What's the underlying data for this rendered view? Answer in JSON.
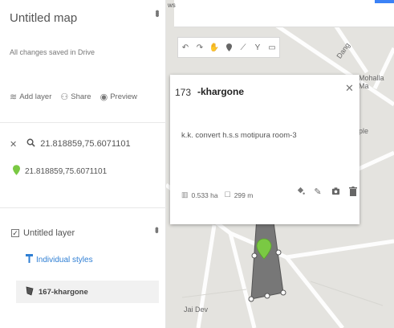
{
  "app": {
    "title": "Untitled map",
    "save_status": "All changes saved in Drive",
    "kebab_icon": "more-vert-icon"
  },
  "toolbar": {
    "add_layer_label": "Add layer",
    "share_label": "Share",
    "preview_label": "Preview"
  },
  "search": {
    "query": "21.818859,75.6071101",
    "result": "21.818859,75.6071101",
    "result_pin_color": "#7ac943"
  },
  "layer": {
    "name": "Untitled layer",
    "styles_label": "Individual styles",
    "feature_name": "167-khargone",
    "checked": true
  },
  "map": {
    "zoom_label": "ws",
    "labels": [
      "Dang",
      "Mohalla Ma",
      "ple",
      "Jai Dev"
    ],
    "draw_tools": [
      "undo-icon",
      "redo-icon",
      "hand-icon",
      "marker-icon",
      "line-icon",
      "route-icon",
      "ruler-icon"
    ],
    "accent_color": "#3b82f6",
    "polygon_color": "#666666",
    "marker_color": "#7ac943"
  },
  "popup": {
    "id": "173",
    "name": "-khargone",
    "description": "k.k. convert h.s.s motipura room-3",
    "area": "0.533 ha",
    "perimeter": "299 m",
    "actions": [
      "paint-bucket-icon",
      "edit-icon",
      "camera-icon",
      "delete-icon"
    ]
  }
}
